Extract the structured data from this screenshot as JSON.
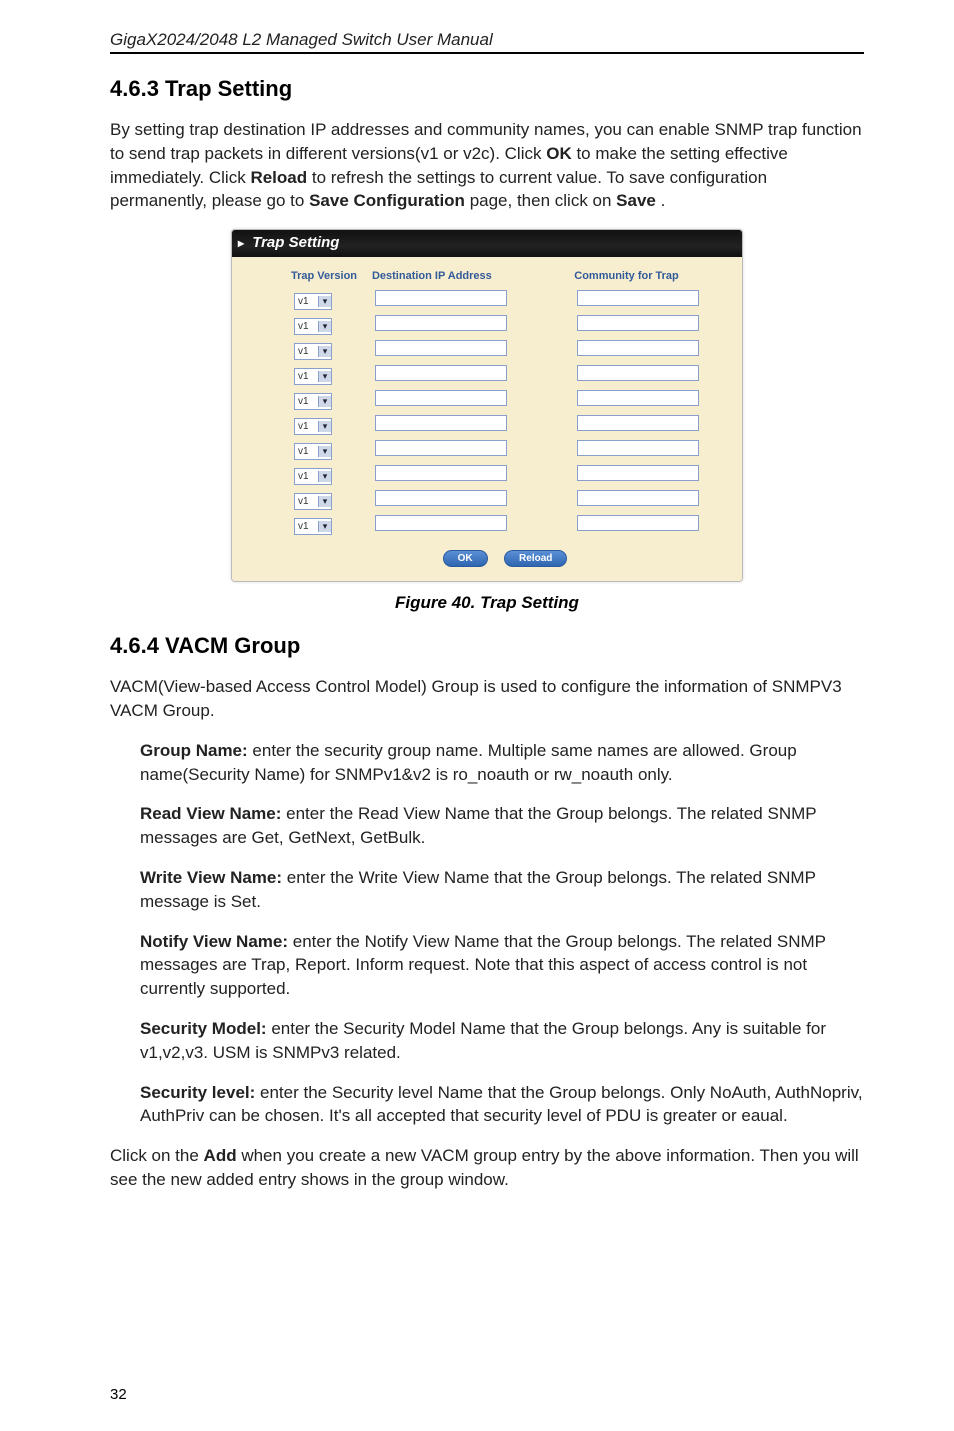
{
  "header": "GigaX2024/2048 L2 Managed Switch User Manual",
  "section_1": {
    "heading": "4.6.3 Trap Setting",
    "para_parts": [
      "By setting trap destination IP addresses and community names, you can enable SNMP trap function to send trap packets in different versions(v1 or v2c). Click ",
      "OK",
      " to make the setting effective immediately. Click ",
      "Reload",
      " to refresh the settings to current value. To save configuration permanently, please go to ",
      "Save Configuration",
      " page, then click on ",
      "Save",
      "."
    ]
  },
  "screenshot": {
    "title": "Trap Setting",
    "columns": {
      "ver": "Trap Version",
      "ip": "Destination IP Address",
      "comm": "Community for Trap"
    },
    "row_version_label": "v1",
    "buttons": {
      "ok": "OK",
      "reload": "Reload"
    }
  },
  "figure_caption": "Figure 40. Trap Setting",
  "section_2": {
    "heading": "4.6.4 VACM Group",
    "intro": "VACM(View-based Access Control Model) Group is used to configure the information of SNMPV3 VACM Group.",
    "items": [
      {
        "lead": "Group Name:",
        "text": " enter the security group name. Multiple same names are allowed. Group name(Security Name) for SNMPv1&v2 is ro_noauth or rw_noauth only."
      },
      {
        "lead": "Read View Name:",
        "text": " enter the Read View Name that the Group belongs. The related SNMP messages are Get, GetNext, GetBulk."
      },
      {
        "lead": "Write View Name:",
        "text": " enter the Write View Name that the Group belongs. The related SNMP message is Set."
      },
      {
        "lead": "Notify View Name:",
        "text": " enter the Notify View Name that the Group belongs. The related SNMP messages are Trap, Report. Inform request. Note that this aspect of access control is not currently supported."
      },
      {
        "lead": "Security Model:",
        "text": " enter the Security Model Name that the Group belongs. Any is suitable for v1,v2,v3. USM is SNMPv3 related."
      },
      {
        "lead": "Security level:",
        "text": " enter the Security level Name that the Group belongs. Only NoAuth, AuthNopriv, AuthPriv can be chosen. It's all accepted that security level of PDU is greater or eaual."
      }
    ],
    "outro_parts": [
      "Click on the ",
      "Add",
      " when you create a new VACM group entry by the above information. Then you will see the new added entry shows in the group window."
    ]
  },
  "page_number": "32"
}
